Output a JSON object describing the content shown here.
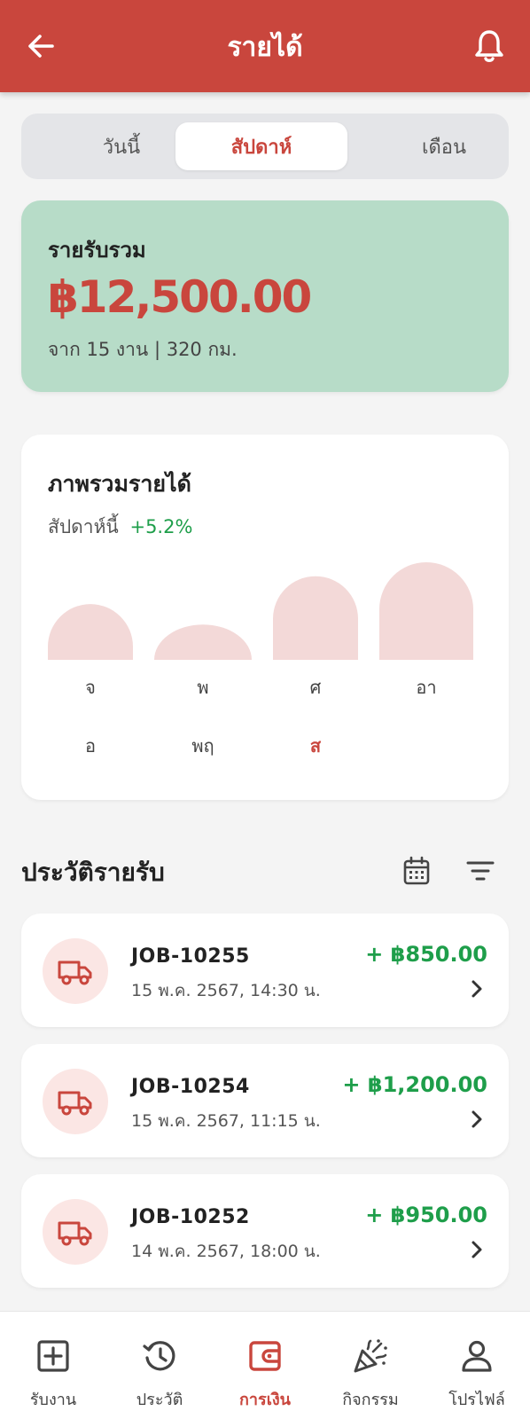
{
  "header": {
    "title": "รายได้",
    "back_icon": "arrow-left-icon",
    "bell_icon": "bell-icon"
  },
  "tabs": [
    {
      "label": "วันนี้",
      "active": false
    },
    {
      "label": "สัปดาห์",
      "active": true
    },
    {
      "label": "เดือน",
      "active": false
    }
  ],
  "summary": {
    "label": "รายรับรวม",
    "amount": "฿12,500.00",
    "subtitle": "จาก 15 งาน | 320 กม."
  },
  "overview": {
    "title": "ภาพรวมรายได้",
    "period": "สัปดาห์นี้",
    "change": "+5.2%"
  },
  "chart_data": {
    "type": "bar",
    "categories": [
      "จ",
      "พ",
      "ศ",
      "อา",
      "อ",
      "พฤ",
      "ส"
    ],
    "values": [
      60,
      38,
      90,
      105,
      null,
      null,
      null
    ],
    "highlighted": "ส",
    "bar_color": "#f3d9d8",
    "highlight_color": "#c9463d"
  },
  "history": {
    "title": "ประวัติรายรับ",
    "calendar_icon": "calendar-icon",
    "filter_icon": "filter-icon",
    "items": [
      {
        "job": "JOB-10255",
        "date": "15 พ.ค. 2567, 14:30 น.",
        "amount": "+ ฿850.00",
        "icon": "truck-icon"
      },
      {
        "job": "JOB-10254",
        "date": "15 พ.ค. 2567, 11:15 น.",
        "amount": "+ ฿1,200.00",
        "icon": "truck-icon"
      },
      {
        "job": "JOB-10252",
        "date": "14 พ.ค. 2567, 18:00 น.",
        "amount": "+ ฿950.00",
        "icon": "truck-icon"
      }
    ]
  },
  "nav": {
    "items": [
      {
        "label": "รับงาน",
        "icon": "plus-square-icon",
        "active": false
      },
      {
        "label": "ประวัติ",
        "icon": "history-icon",
        "active": false
      },
      {
        "label": "การเงิน",
        "icon": "wallet-icon",
        "active": true
      },
      {
        "label": "กิจกรรม",
        "icon": "party-icon",
        "active": false
      },
      {
        "label": "โปรไฟล์",
        "icon": "person-icon",
        "active": false
      }
    ]
  },
  "colors": {
    "primary": "#c9463d",
    "positive": "#1e9e4a",
    "summary_bg": "#b7dcc8"
  }
}
